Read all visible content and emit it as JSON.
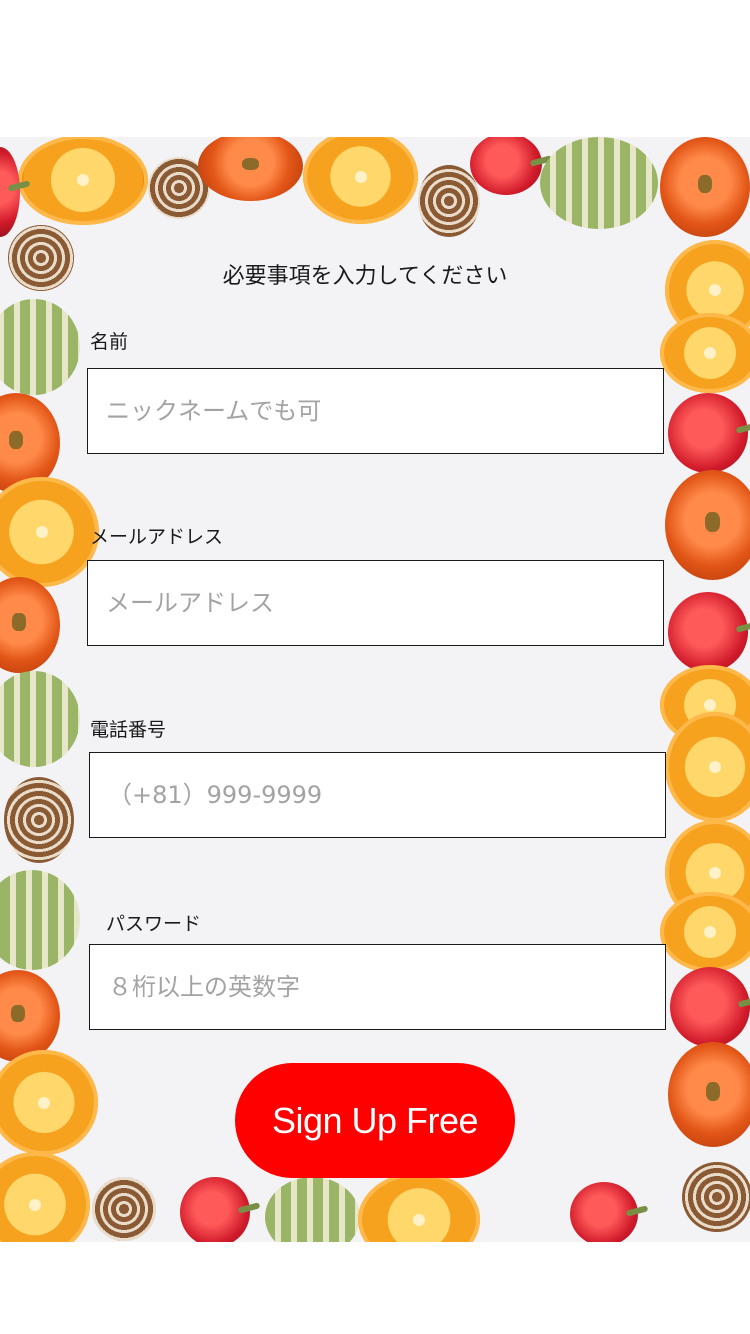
{
  "form": {
    "heading": "必要事項を入力してください",
    "name_label": "名前",
    "name_placeholder": "ニックネームでも可",
    "email_label": "メールアドレス",
    "email_placeholder": "メールアドレス",
    "phone_label": "電話番号",
    "phone_placeholder": "（+81）999-9999",
    "password_label": "パスワード",
    "password_placeholder": "８桁以上の英数字",
    "submit_label": "Sign Up Free"
  },
  "colors": {
    "accent": "#ff0000",
    "background": "#f3f3f6"
  }
}
